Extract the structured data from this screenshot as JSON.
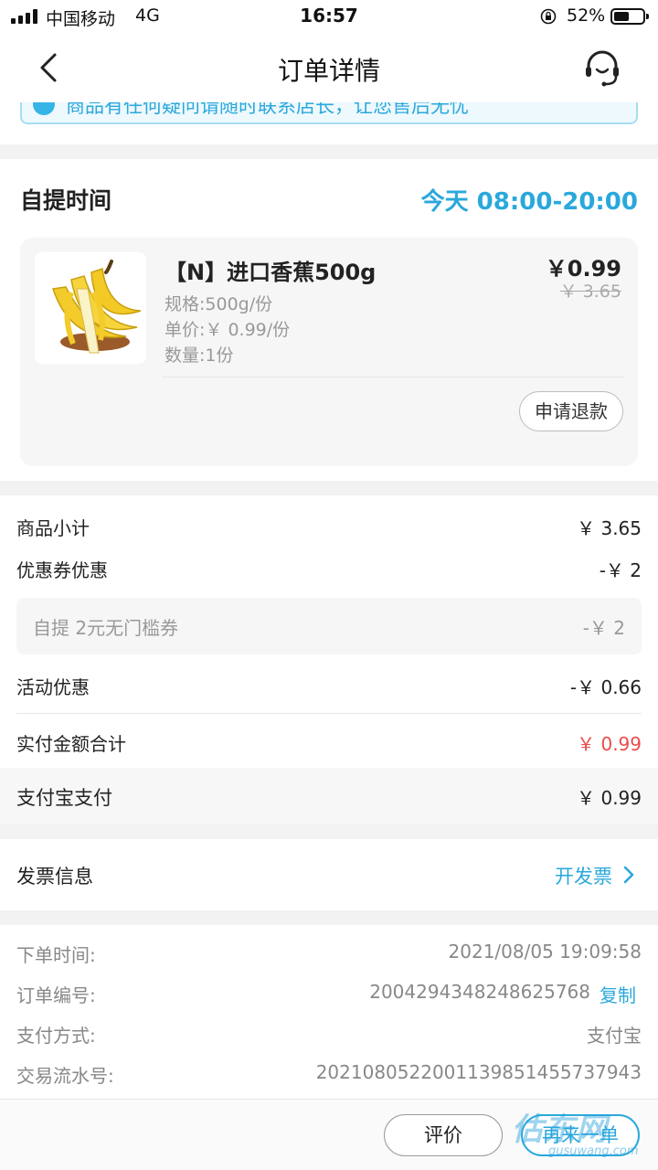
{
  "status_bar": {
    "carrier": "中国移动",
    "network": "4G",
    "time": "16:57",
    "battery_percent": "52%",
    "battery_level": 0.52
  },
  "nav": {
    "title": "订单详情",
    "back_icon": "chevron-left-icon",
    "service_icon": "customer-service-icon"
  },
  "notice": {
    "text": "商品有任何疑问请随时联系店长，让您售后无忧"
  },
  "pickup": {
    "label": "自提时间",
    "time": "今天 08:00-20:00",
    "item": {
      "name": "【N】进口香蕉500g",
      "spec": "规格:500g/份",
      "unit_price": "单价:￥ 0.99/份",
      "quantity": "数量:1份",
      "price": "￥0.99",
      "original_price": "￥ 3.65",
      "refund_button": "申请退款"
    }
  },
  "summary": {
    "subtotal_label": "商品小计",
    "subtotal_value": "￥ 3.65",
    "coupon_label": "优惠券优惠",
    "coupon_value": "-￥ 2",
    "coupon_detail_label": "自提 2元无门槛券",
    "coupon_detail_value": "-￥ 2",
    "activity_label": "活动优惠",
    "activity_value": "-￥ 0.66",
    "total_label": "实付金额合计",
    "total_value": "￥ 0.99",
    "payment_label": "支付宝支付",
    "payment_value": "￥ 0.99"
  },
  "invoice": {
    "label": "发票信息",
    "action": "开发票"
  },
  "order_info": {
    "time_label": "下单时间:",
    "time_value": "2021/08/05 19:09:58",
    "number_label": "订单编号:",
    "number_value": "2004294348248625768",
    "copy_label": "复制",
    "pay_method_label": "支付方式:",
    "pay_method_value": "支付宝",
    "serial_label": "交易流水号:",
    "serial_value": "2021080522001139851455737943"
  },
  "bottom_bar": {
    "rate_button": "评价",
    "reorder_button": "再来一单"
  },
  "watermark": {
    "text": "估东网",
    "url": "gusuwang.com"
  },
  "colors": {
    "accent": "#2aa8dc",
    "price_red": "#e94b4b",
    "text": "#222222",
    "muted": "#999999"
  }
}
